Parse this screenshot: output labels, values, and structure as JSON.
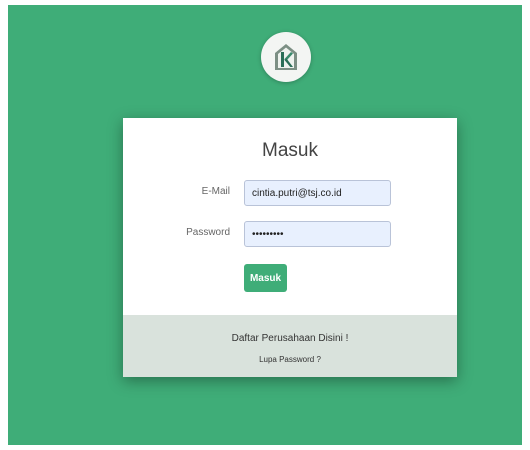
{
  "brand": {
    "logo_icon": "house-k-logo-icon",
    "accent_color": "#3fad78"
  },
  "login": {
    "title": "Masuk",
    "email_label": "E-Mail",
    "email_value": "cintia.putri@tsj.co.id",
    "password_label": "Password",
    "password_value": "cintiaput",
    "submit_label": "Masuk"
  },
  "footer": {
    "register_link": "Daftar Perusahaan Disini !",
    "forgot_link": "Lupa Password ?"
  }
}
